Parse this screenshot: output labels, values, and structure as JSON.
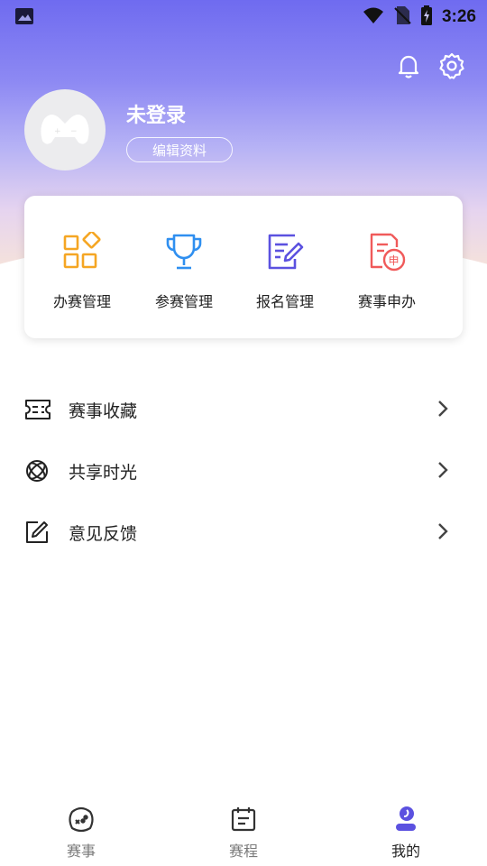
{
  "status_bar": {
    "time": "3:26"
  },
  "profile": {
    "username": "未登录",
    "edit_label": "编辑资料"
  },
  "quick_actions": [
    {
      "label": "办赛管理",
      "icon": "apps-grid-icon",
      "color": "#f5a623"
    },
    {
      "label": "参赛管理",
      "icon": "trophy-icon",
      "color": "#2f8ff0"
    },
    {
      "label": "报名管理",
      "icon": "edit-form-icon",
      "color": "#5b51e0"
    },
    {
      "label": "赛事申办",
      "icon": "apply-document-icon",
      "color": "#f05a5a"
    }
  ],
  "menu": [
    {
      "label": "赛事收藏",
      "icon": "ticket-icon"
    },
    {
      "label": "共享时光",
      "icon": "orbit-icon"
    },
    {
      "label": "意见反馈",
      "icon": "feedback-edit-icon"
    }
  ],
  "tabs": [
    {
      "label": "赛事",
      "icon": "game-icon",
      "active": false
    },
    {
      "label": "赛程",
      "icon": "schedule-icon",
      "active": false
    },
    {
      "label": "我的",
      "icon": "profile-icon",
      "active": true
    }
  ],
  "colors": {
    "accent": "#5b51e0",
    "header_gradient_top": "#6f6bf0",
    "header_gradient_bottom": "#f6e3da"
  }
}
